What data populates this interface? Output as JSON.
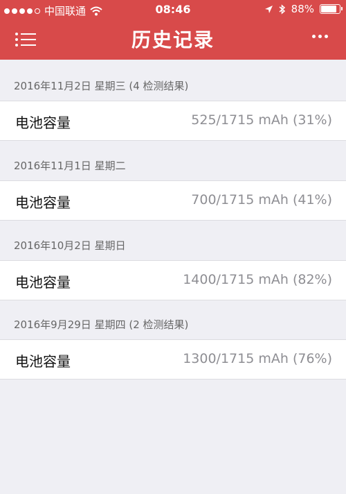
{
  "status_bar": {
    "carrier": "中国联通",
    "time": "08:46",
    "battery_percent": "88%",
    "battery_level": 0.88,
    "signal_bars_filled": 4,
    "signal_bars_total": 5
  },
  "nav": {
    "title": "历史记录"
  },
  "colors": {
    "header": "#d84a4a",
    "background": "#efeff4",
    "value_text": "#8e8e93"
  },
  "records": [
    {
      "date": "2016年11月2日 星期三 (4 检测结果)",
      "label": "电池容量",
      "value": "525/1715 mAh (31%)"
    },
    {
      "date": "2016年11月1日 星期二",
      "label": "电池容量",
      "value": "700/1715 mAh (41%)"
    },
    {
      "date": "2016年10月2日 星期日",
      "label": "电池容量",
      "value": "1400/1715 mAh (82%)"
    },
    {
      "date": "2016年9月29日 星期四 (2 检测结果)",
      "label": "电池容量",
      "value": "1300/1715 mAh (76%)"
    }
  ]
}
